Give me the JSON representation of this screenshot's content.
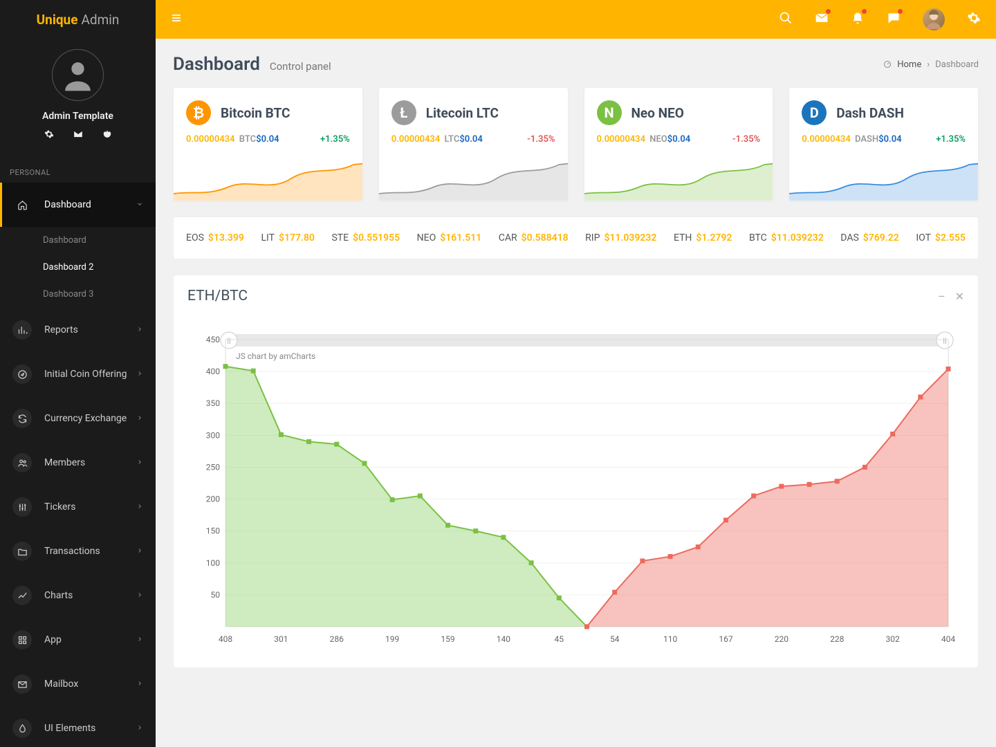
{
  "brand": {
    "bold": "Unique",
    "light": "Admin"
  },
  "profile": {
    "label": "Admin Template"
  },
  "sidebar": {
    "section_personal": "PERSONAL",
    "dashboard": "Dashboard",
    "sub": {
      "d1": "Dashboard",
      "d2": "Dashboard 2",
      "d3": "Dashboard 3"
    },
    "reports": "Reports",
    "ico": "Initial Coin Offering",
    "exchange": "Currency Exchange",
    "members": "Members",
    "tickers": "Tickers",
    "transactions": "Transactions",
    "charts": "Charts",
    "app": "App",
    "mailbox": "Mailbox",
    "ui": "UI Elements"
  },
  "header": {
    "title": "Dashboard",
    "subtitle": "Control panel",
    "breadcrumb_home": "Home",
    "breadcrumb_current": "Dashboard"
  },
  "cards": [
    {
      "title": "Bitcoin BTC",
      "icon_bg": "#ff9500",
      "glyph": "₿",
      "amount": "0.00000434",
      "sym": "BTC",
      "usd": "$0.04",
      "pct": "+1.35%",
      "dir": "up",
      "stroke": "#ff9500",
      "fill": "rgba(255,149,0,0.25)"
    },
    {
      "title": "Litecoin LTC",
      "icon_bg": "#9c9c9c",
      "glyph": "Ł",
      "amount": "0.00000434",
      "sym": "LTC",
      "usd": "$0.04",
      "pct": "-1.35%",
      "dir": "down",
      "stroke": "#9c9c9c",
      "fill": "rgba(156,156,156,0.25)"
    },
    {
      "title": "Neo NEO",
      "icon_bg": "#7bc043",
      "glyph": "N",
      "amount": "0.00000434",
      "sym": "NEO",
      "usd": "$0.04",
      "pct": "-1.35%",
      "dir": "down",
      "stroke": "#7bc043",
      "fill": "rgba(123,192,67,0.25)"
    },
    {
      "title": "Dash DASH",
      "icon_bg": "#1c75bc",
      "glyph": "D",
      "amount": "0.00000434",
      "sym": "DASH",
      "usd": "$0.04",
      "pct": "+1.35%",
      "dir": "up",
      "stroke": "#3a8dde",
      "fill": "rgba(58,141,222,0.25)"
    }
  ],
  "ticker": [
    {
      "sym": "EOS",
      "price": "$13.399"
    },
    {
      "sym": "LIT",
      "price": "$177.80"
    },
    {
      "sym": "STE",
      "price": "$0.551955"
    },
    {
      "sym": "NEO",
      "price": "$161.511"
    },
    {
      "sym": "CAR",
      "price": "$0.588418"
    },
    {
      "sym": "RIP",
      "price": "$11.039232"
    },
    {
      "sym": "ETH",
      "price": "$1.2792"
    },
    {
      "sym": "BTC",
      "price": "$11.039232"
    },
    {
      "sym": "DAS",
      "price": "$769.22"
    },
    {
      "sym": "IOT",
      "price": "$2.555"
    }
  ],
  "chart": {
    "title": "ETH/BTC",
    "credit": "JS chart by amCharts"
  },
  "chart_data": {
    "type": "area",
    "title": "ETH/BTC",
    "ylabel": "",
    "xlabel": "",
    "ylim": [
      0,
      450
    ],
    "yticks": [
      50,
      100,
      150,
      200,
      250,
      300,
      350,
      400,
      450
    ],
    "series": [
      {
        "name": "green",
        "x": [
          0,
          1,
          2,
          3,
          4,
          5,
          6,
          7,
          8,
          9,
          10,
          11,
          12,
          13
        ],
        "values": [
          408,
          401,
          301,
          290,
          286,
          256,
          199,
          205,
          159,
          150,
          140,
          100,
          45,
          0
        ],
        "stroke": "#7bc043",
        "fill": "rgba(146,213,114,0.45)"
      },
      {
        "name": "red",
        "x": [
          13,
          14,
          15,
          16,
          17,
          18,
          19,
          20,
          21,
          22,
          23,
          24,
          25,
          26
        ],
        "values": [
          0,
          54,
          103,
          110,
          125,
          167,
          205,
          220,
          223,
          228,
          250,
          302,
          360,
          404
        ],
        "stroke": "#ed6a5e",
        "fill": "rgba(237,106,94,0.40)"
      }
    ],
    "xtick_indices": [
      0,
      2,
      4,
      6,
      8,
      10,
      12,
      14,
      16,
      18,
      20,
      22,
      24,
      26
    ],
    "xtick_labels": [
      "408",
      "301",
      "286",
      "199",
      "159",
      "140",
      "45",
      "54",
      "110",
      "167",
      "220",
      "228",
      "302",
      "404"
    ]
  }
}
